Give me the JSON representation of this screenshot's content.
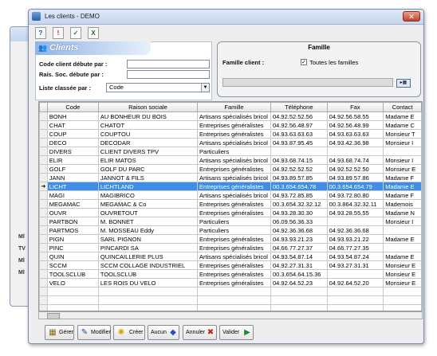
{
  "window": {
    "title": "Les clients - DEMO"
  },
  "toolbar": {
    "icons": [
      "help-icon",
      "options-icon",
      "validate-icon",
      "excel-icon"
    ]
  },
  "search": {
    "banner": "Clients",
    "code_label": "Code client débute par :",
    "code_value": "",
    "raison_label": "Rais. Soc. débute par :",
    "raison_value": "",
    "order_label": "Liste classée par :",
    "order_value": "Code"
  },
  "famille": {
    "heading": "Famille",
    "client_label": "Famille client :",
    "all_label": "Toutes les familles",
    "all_checked": true,
    "field_value": ""
  },
  "table": {
    "columns": [
      "Code",
      "Raison sociale",
      "Famille",
      "Téléphone",
      "Fax",
      "Contact"
    ],
    "selected_index": 8,
    "rows": [
      [
        "BONH",
        "AU BONHEUR DU BOIS",
        "Artisans spécialisés bricol",
        "04.92.52.52.56",
        "04.92.56.58.55",
        "Madame E"
      ],
      [
        "CHAT",
        "CHATOT",
        "Entreprises généralistes",
        "04.92.56.48.97",
        "04.92.56.48.99",
        "Madame C"
      ],
      [
        "COUP",
        "COUPTOU",
        "Entreprises généralistes",
        "04.93.63.63.63",
        "04.93.63.63.63",
        "Monsieur T"
      ],
      [
        "DECO",
        "DECODAR",
        "Artisans spécialisés bricol",
        "04.93.87.95.45",
        "04.93.42.36.98",
        "Monsieur I"
      ],
      [
        "DIVERS",
        "CLIENT DIVERS TPV",
        "Particuliers",
        "",
        "",
        ""
      ],
      [
        "ELIR",
        "ELIR MATOS",
        "Artisans spécialisés bricol",
        "04.93.68.74.15",
        "04.93.68.74.74",
        "Monsieur I"
      ],
      [
        "GOLF",
        "GOLF DU PARC",
        "Entreprises généralistes",
        "04.92.52.52.52",
        "04.92.52.52.50",
        "Monsieur E"
      ],
      [
        "JANN",
        "JANNOT & FILS",
        "Artisans spécialisés bricol",
        "04.93.89.57.85",
        "04.93.89.57.86",
        "Madame F"
      ],
      [
        "LICHT",
        "LICHTLAND",
        "Entreprises généralistes",
        "00.3.654.654.78",
        "00.3.654.654.79",
        "Madame E"
      ],
      [
        "MAGI",
        "MAGIBRICO",
        "Artisans spécialisés bricol",
        "04.93.72.85.85",
        "04.93.72.80.80",
        "Madame F"
      ],
      [
        "MEGAMAC",
        "MEGAMAC & Co",
        "Entreprises généralistes",
        "00.3.654.32.32.12",
        "00.3.864.32.32.11",
        "Mademois"
      ],
      [
        "OUVR",
        "OUVRETOUT",
        "Entreprises généralistes",
        "04.93.28.30.30",
        "04.93.28.55.55",
        "Madame N"
      ],
      [
        "PARTBON",
        "M. BONNET",
        "Particuliers",
        "06.09.56.36.33",
        "",
        "Monsieur I"
      ],
      [
        "PARTMOS",
        "M. MOSSEAU Eddy",
        "Particuliers",
        "04.92.36.36.68",
        "04.92.36.36.68",
        ""
      ],
      [
        "PIGN",
        "SARL PIGNON",
        "Entreprises généralistes",
        "04.93.93.21.23",
        "04.93.93.21.22",
        "Madame E"
      ],
      [
        "PINC",
        "PINCARDI SA",
        "Entreprises généralistes",
        "04.66.77.27.37",
        "04.66.77.27.35",
        ""
      ],
      [
        "QUIN",
        "QUINCAILLERIE PLUS",
        "Artisans spécialisés bricol",
        "04.93.54.87.14",
        "04.93.54.87.24",
        "Madame E"
      ],
      [
        "SCCM",
        "SCCM COLLAGE INDUSTRIEL",
        "Entreprises généralistes",
        "04.92.27.31.31",
        "04.93.27.31.31",
        "Monsieur E"
      ],
      [
        "TOOLSCLUB",
        "TOOLSCLUB",
        "Entreprises généralistes",
        "00.3.654.64.15.36",
        "",
        "Monsieur E"
      ],
      [
        "VELO",
        "LES ROIS DU VELO",
        "Entreprises généralistes",
        "04.92.64.52.23",
        "04.92.64.52.20",
        "Monsieur E"
      ]
    ]
  },
  "buttons": {
    "gerer": "Gérer",
    "modifier": "Modifier",
    "creer": "Créer",
    "aucun": "Aucun",
    "annuler": "Annuler",
    "valider": "Valider"
  },
  "colors": {
    "selection": "#3d8ee8",
    "banner": "#8fb3e6",
    "close": "#c2412b"
  }
}
